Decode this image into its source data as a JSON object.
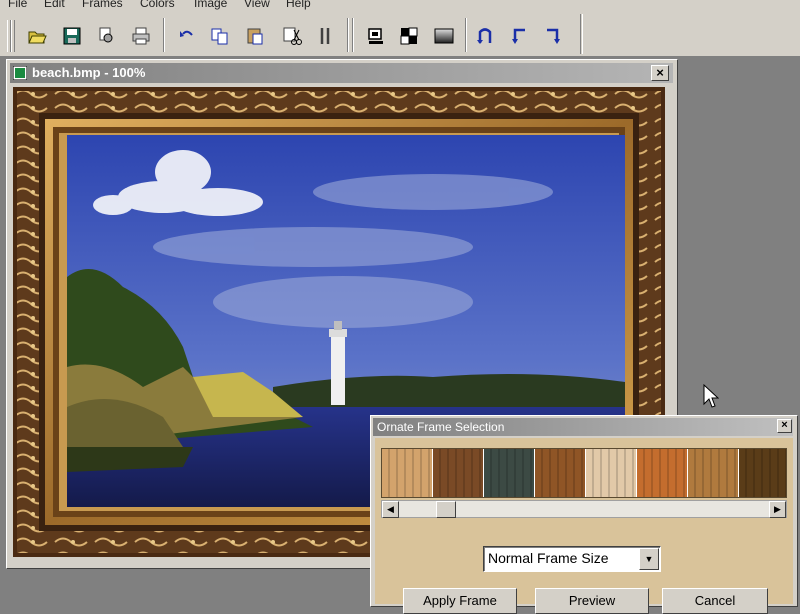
{
  "menu": [
    "File",
    "Edit",
    "Frames",
    "Colors",
    "Image",
    "View",
    "Help"
  ],
  "toolbar": {
    "buttons": [
      {
        "icon": "open-folder-icon"
      },
      {
        "icon": "save-disk-icon"
      },
      {
        "icon": "print-preview-icon"
      },
      {
        "icon": "print-icon"
      },
      {
        "icon": "undo-icon"
      },
      {
        "icon": "copy-icon"
      },
      {
        "icon": "paste-icon"
      },
      {
        "icon": "cut-icon"
      },
      {
        "icon": "tool-icon"
      },
      {
        "icon": "frame-icon"
      },
      {
        "icon": "checker-icon"
      },
      {
        "icon": "gradient-icon"
      },
      {
        "icon": "rotate-icon"
      },
      {
        "icon": "rotate-left-icon"
      },
      {
        "icon": "rotate-right-icon"
      }
    ]
  },
  "document": {
    "title": "beach.bmp - 100%",
    "close_label": "×"
  },
  "dialog": {
    "title": "Ornate Frame Selection",
    "close_label": "×",
    "frame_size_selected": "Normal Frame Size",
    "swatches": [
      "#d3a36c",
      "#7a4a26",
      "#3c4a44",
      "#8f5526",
      "#e2c9a8",
      "#c46d2e",
      "#b07a3e",
      "#5a3c18"
    ],
    "buttons": {
      "apply": "Apply Frame",
      "preview": "Preview",
      "cancel": "Cancel"
    }
  },
  "colors": {
    "accent_blue": "#1a2ea8",
    "dialog_bg": "#d9c39a",
    "frame_gold": "#b0823c"
  }
}
